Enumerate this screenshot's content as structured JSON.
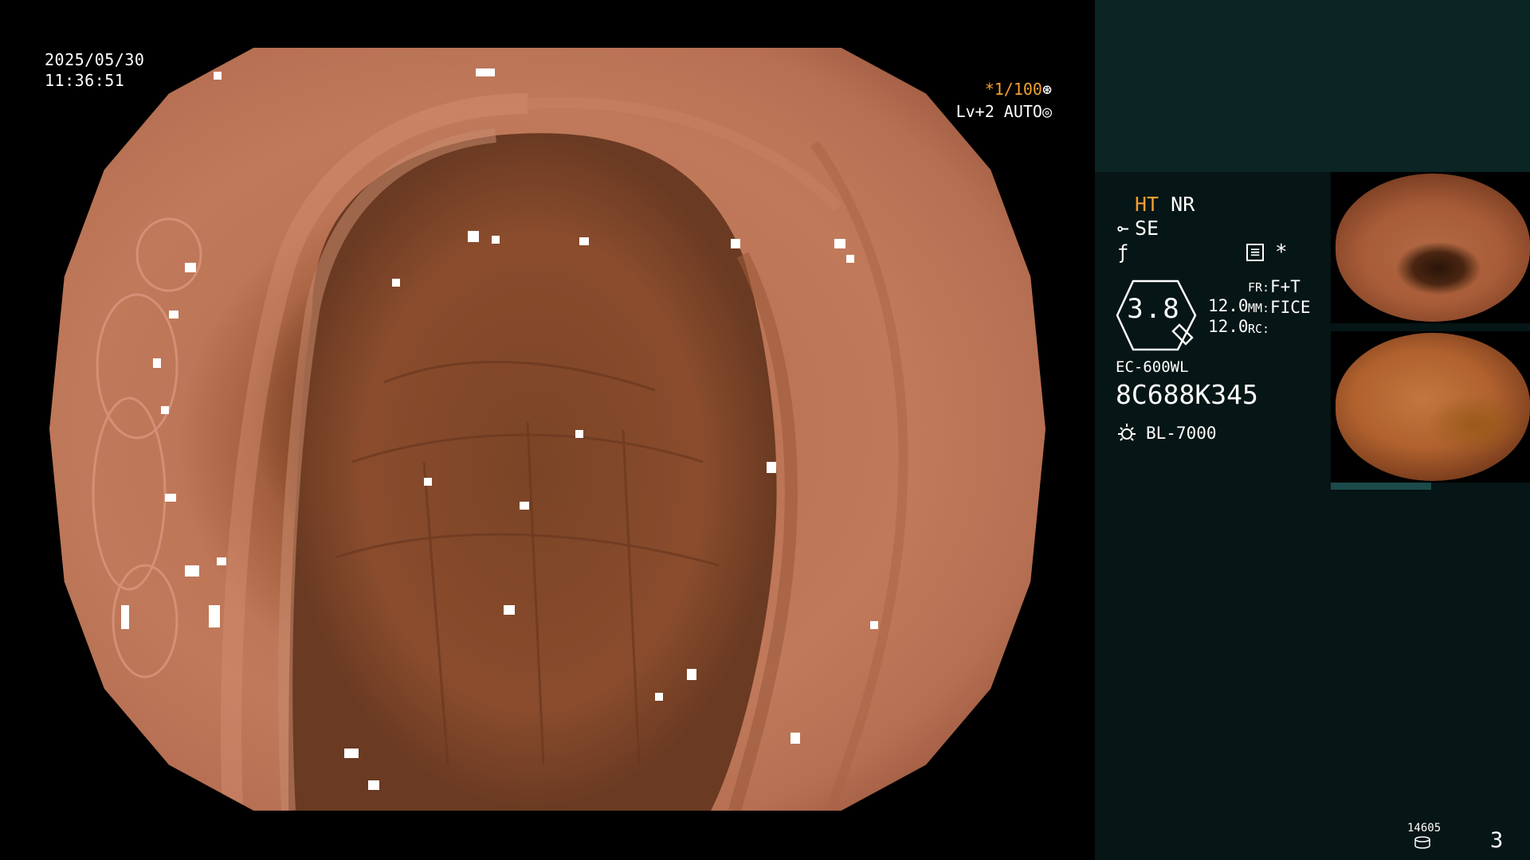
{
  "overlay": {
    "date": "2025/05/30",
    "time": "11:36:51",
    "shutter": "*1/100",
    "shutter_icon": "aperture-icon",
    "level": "Lv+2 AUTO",
    "level_icon": "iris-icon"
  },
  "panel": {
    "ht_label": "HT",
    "nr_label": "NR",
    "se_label": "SE",
    "se_icon": "structure-enhance-icon",
    "f_icon": "color-mode-icon",
    "menu_icon": "menu-icon",
    "star": "*",
    "gauge_value": "3.8",
    "value1": "12.0",
    "value2": "12.0",
    "fr_label": "FR:",
    "fr_value": "F+T",
    "mm_label": "MM:",
    "mm_value": "FICE",
    "rc_label": "RC:",
    "scope_model": "EC-600WL",
    "scope_serial": "8C688K345",
    "light_source": "BL-7000",
    "light_icon": "lamp-icon",
    "image_count": "14605",
    "storage_icon": "disk-icon",
    "page_number": "3"
  },
  "colors": {
    "panel_bg": "#061515",
    "panel_top": "#0b2424",
    "accent_orange": "#f0a030"
  }
}
